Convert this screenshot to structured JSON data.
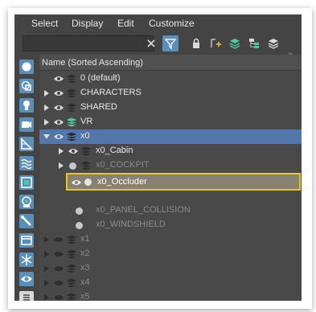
{
  "menu": {
    "items": [
      "Select",
      "Display",
      "Edit",
      "Customize"
    ]
  },
  "toolbar": {
    "search_placeholder": "",
    "more": "»"
  },
  "header": {
    "label": "Name (Sorted Ascending)"
  },
  "rows": [
    {
      "label": "0 (default)"
    },
    {
      "label": "CHARACTERS"
    },
    {
      "label": "SHARED"
    },
    {
      "label": "VR"
    },
    {
      "label": "x0"
    },
    {
      "label": "x0_Cabin"
    },
    {
      "label": "x0_COCKPIT"
    },
    {
      "label": "x0_Occluder"
    },
    {
      "label": "x0_PANEL_COLLISION"
    },
    {
      "label": "x0_WINDSHIELD"
    },
    {
      "label": "x1"
    },
    {
      "label": "x2"
    },
    {
      "label": "x3"
    },
    {
      "label": "x4"
    },
    {
      "label": "x5"
    }
  ],
  "colors": {
    "accent": "#5b8fb8",
    "selected": "#5277a8",
    "highlight_border": "#e8c91a"
  }
}
